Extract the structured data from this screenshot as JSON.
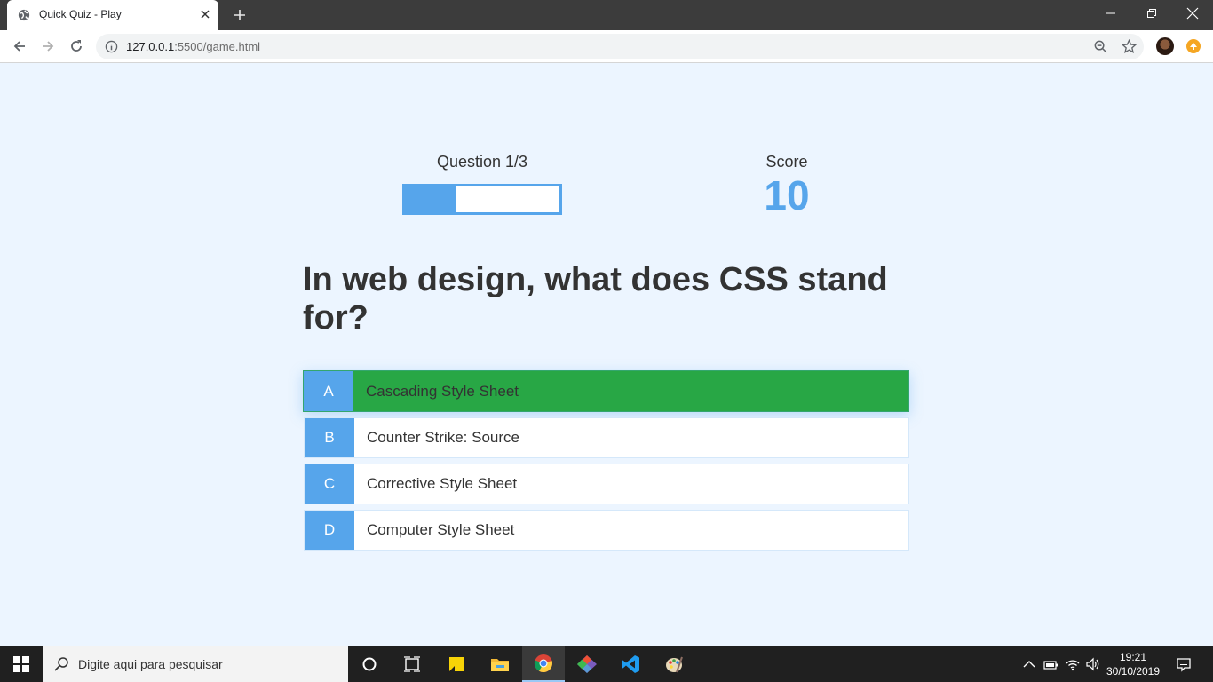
{
  "browser": {
    "tab_title": "Quick Quiz - Play",
    "url_host": "127.0.0.1",
    "url_rest": ":5500/game.html"
  },
  "hud": {
    "question_label": "Question 1/3",
    "progress_fraction": 0.333,
    "score_label": "Score",
    "score_value": "10"
  },
  "question": "In web design, what does CSS stand for?",
  "choices": [
    {
      "prefix": "A",
      "text": "Cascading Style Sheet",
      "state": "correct"
    },
    {
      "prefix": "B",
      "text": "Counter Strike: Source",
      "state": "default"
    },
    {
      "prefix": "C",
      "text": "Corrective Style Sheet",
      "state": "default"
    },
    {
      "prefix": "D",
      "text": "Computer Style Sheet",
      "state": "default"
    }
  ],
  "colors": {
    "accent": "#56a5eb",
    "correct": "#28a745",
    "background": "#ecf5ff"
  },
  "taskbar": {
    "search_placeholder": "Digite aqui para pesquisar",
    "time": "19:21",
    "date": "30/10/2019"
  }
}
